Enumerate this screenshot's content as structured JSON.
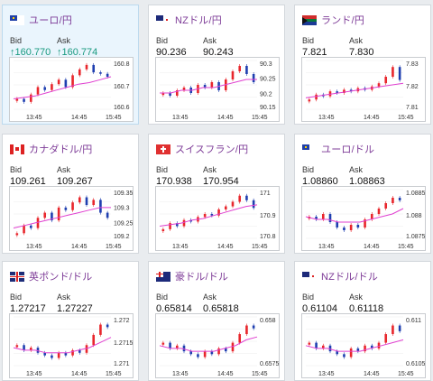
{
  "cards": [
    {
      "pair": "ユーロ/円",
      "flag": "eu",
      "active": true,
      "bid_label": "Bid",
      "ask_label": "Ask",
      "bid": "160.770",
      "ask": "160.774",
      "bid_arrow": "↑",
      "ask_arrow": "↑",
      "trend": "up",
      "y_labels": [
        "160.8",
        "160.7",
        "160.6"
      ],
      "x_labels": [
        "13:45",
        "14:45",
        "15:45"
      ],
      "chart_data": {
        "type": "candlestick",
        "x": [
          "13:45",
          "14:45",
          "15:45"
        ],
        "close": [
          160.62,
          160.6,
          160.65,
          160.7,
          160.68,
          160.72,
          160.75,
          160.7,
          160.78,
          160.82,
          160.85,
          160.8,
          160.79,
          160.77
        ],
        "ma": [
          160.62,
          160.63,
          160.64,
          160.66,
          160.68,
          160.7,
          160.72,
          160.73,
          160.75,
          160.77
        ],
        "ylim": [
          160.55,
          160.88
        ]
      }
    },
    {
      "pair": "NZドル/円",
      "flag": "nz",
      "active": false,
      "bid_label": "Bid",
      "ask_label": "Ask",
      "bid": "90.236",
      "ask": "90.243",
      "bid_arrow": "",
      "ask_arrow": "",
      "trend": "",
      "y_labels": [
        "90.3",
        "90.25",
        "90.2",
        "90.15"
      ],
      "x_labels": [
        "13:45",
        "14:45",
        "15:45"
      ],
      "chart_data": {
        "type": "candlestick",
        "x": [
          "13:45",
          "14:45",
          "15:45"
        ],
        "close": [
          90.2,
          90.19,
          90.21,
          90.22,
          90.2,
          90.23,
          90.22,
          90.24,
          90.21,
          90.25,
          90.28,
          90.3,
          90.27,
          90.24
        ],
        "ma": [
          90.2,
          90.2,
          90.21,
          90.21,
          90.22,
          90.22,
          90.23,
          90.24,
          90.25,
          90.25
        ],
        "ylim": [
          90.14,
          90.32
        ]
      }
    },
    {
      "pair": "ランド/円",
      "flag": "za",
      "active": false,
      "bid_label": "Bid",
      "ask_label": "Ask",
      "bid": "7.821",
      "ask": "7.830",
      "bid_arrow": "",
      "ask_arrow": "",
      "trend": "",
      "y_labels": [
        "7.83",
        "7.82",
        "7.81"
      ],
      "x_labels": [
        "13:45",
        "14:45",
        "15:45"
      ],
      "chart_data": {
        "type": "candlestick",
        "x": [
          "13:45",
          "14:45",
          "15:45"
        ],
        "close": [
          7.812,
          7.815,
          7.814,
          7.817,
          7.816,
          7.818,
          7.817,
          7.819,
          7.818,
          7.82,
          7.822,
          7.826,
          7.832,
          7.824
        ],
        "ma": [
          7.813,
          7.814,
          7.815,
          7.816,
          7.817,
          7.818,
          7.819,
          7.82,
          7.821,
          7.822
        ],
        "ylim": [
          7.806,
          7.836
        ]
      }
    },
    {
      "pair": "カナダドル/円",
      "flag": "ca",
      "active": false,
      "bid_label": "Bid",
      "ask_label": "Ask",
      "bid": "109.261",
      "ask": "109.267",
      "bid_arrow": "",
      "ask_arrow": "",
      "trend": "",
      "y_labels": [
        "109.35",
        "109.3",
        "109.25",
        "109.2"
      ],
      "x_labels": [
        "13:45",
        "14:45",
        "15:45"
      ],
      "chart_data": {
        "type": "candlestick",
        "x": [
          "13:45",
          "14:45",
          "15:45"
        ],
        "close": [
          109.2,
          109.23,
          109.22,
          109.26,
          109.28,
          109.25,
          109.3,
          109.29,
          109.32,
          109.34,
          109.31,
          109.33,
          109.28,
          109.26
        ],
        "ma": [
          109.22,
          109.23,
          109.24,
          109.25,
          109.26,
          109.27,
          109.28,
          109.29,
          109.3,
          109.3
        ],
        "ylim": [
          109.18,
          109.37
        ]
      }
    },
    {
      "pair": "スイスフラン/円",
      "flag": "ch",
      "active": false,
      "bid_label": "Bid",
      "ask_label": "Ask",
      "bid": "170.938",
      "ask": "170.954",
      "bid_arrow": "",
      "ask_arrow": "",
      "trend": "",
      "y_labels": [
        "171",
        "170.9",
        "170.8"
      ],
      "x_labels": [
        "13:45",
        "14:45",
        "15:45"
      ],
      "chart_data": {
        "type": "candlestick",
        "x": [
          "13:45",
          "14:45",
          "15:45"
        ],
        "close": [
          170.8,
          170.84,
          170.82,
          170.86,
          170.85,
          170.88,
          170.9,
          170.89,
          170.93,
          170.95,
          170.98,
          171.02,
          170.99,
          170.94
        ],
        "ma": [
          170.82,
          170.83,
          170.84,
          170.86,
          170.87,
          170.89,
          170.91,
          170.93,
          170.95,
          170.96
        ],
        "ylim": [
          170.74,
          171.06
        ]
      }
    },
    {
      "pair": "ユーロ/ドル",
      "flag": "eu",
      "active": false,
      "bid_label": "Bid",
      "ask_label": "Ask",
      "bid": "1.08860",
      "ask": "1.08863",
      "bid_arrow": "",
      "ask_arrow": "",
      "trend": "",
      "y_labels": [
        "1.0885",
        "1.088",
        "1.0875"
      ],
      "x_labels": [
        "13:45",
        "14:45",
        "15:45"
      ],
      "chart_data": {
        "type": "candlestick",
        "x": [
          "13:45",
          "14:45",
          "15:45"
        ],
        "close": [
          1.088,
          1.0879,
          1.0881,
          1.0878,
          1.0876,
          1.0875,
          1.0877,
          1.0876,
          1.0879,
          1.0881,
          1.0883,
          1.0885,
          1.0887,
          1.0886
        ],
        "ma": [
          1.088,
          1.0879,
          1.0879,
          1.0878,
          1.0878,
          1.0878,
          1.0879,
          1.088,
          1.0881,
          1.0883
        ],
        "ylim": [
          1.0872,
          1.089
        ]
      }
    },
    {
      "pair": "英ポンド/ドル",
      "flag": "gb",
      "active": false,
      "bid_label": "Bid",
      "ask_label": "Ask",
      "bid": "1.27217",
      "ask": "1.27227",
      "bid_arrow": "",
      "ask_arrow": "",
      "trend": "",
      "y_labels": [
        "1.272",
        "1.2715",
        "1.271"
      ],
      "x_labels": [
        "13:45",
        "14:45",
        "15:45"
      ],
      "chart_data": {
        "type": "candlestick",
        "x": [
          "13:45",
          "14:45",
          "15:45"
        ],
        "close": [
          1.2714,
          1.2712,
          1.2713,
          1.2711,
          1.271,
          1.2709,
          1.2711,
          1.271,
          1.2712,
          1.2711,
          1.2714,
          1.2718,
          1.2722,
          1.2721
        ],
        "ma": [
          1.2713,
          1.2712,
          1.2712,
          1.2711,
          1.2711,
          1.2711,
          1.2712,
          1.2713,
          1.2715,
          1.2717
        ],
        "ylim": [
          1.2706,
          1.2725
        ]
      }
    },
    {
      "pair": "豪ドル/ドル",
      "flag": "au",
      "active": false,
      "bid_label": "Bid",
      "ask_label": "Ask",
      "bid": "0.65814",
      "ask": "0.65818",
      "bid_arrow": "",
      "ask_arrow": "",
      "trend": "",
      "y_labels": [
        "0.658",
        "0.6575"
      ],
      "x_labels": [
        "13:45",
        "14:45",
        "15:45"
      ],
      "chart_data": {
        "type": "candlestick",
        "x": [
          "13:45",
          "14:45",
          "15:45"
        ],
        "close": [
          0.6576,
          0.6574,
          0.6575,
          0.6573,
          0.6572,
          0.6571,
          0.6573,
          0.6572,
          0.6574,
          0.6573,
          0.6576,
          0.6579,
          0.6582,
          0.6581
        ],
        "ma": [
          0.6575,
          0.6574,
          0.6574,
          0.6573,
          0.6573,
          0.6573,
          0.6574,
          0.6575,
          0.6577,
          0.6578
        ],
        "ylim": [
          0.6568,
          0.6585
        ]
      }
    },
    {
      "pair": "NZドル/ドル",
      "flag": "nz",
      "active": false,
      "bid_label": "Bid",
      "ask_label": "Ask",
      "bid": "0.61104",
      "ask": "0.61118",
      "bid_arrow": "",
      "ask_arrow": "",
      "trend": "",
      "y_labels": [
        "0.611",
        "0.6105"
      ],
      "x_labels": [
        "13:45",
        "14:45",
        "15:45"
      ],
      "chart_data": {
        "type": "candlestick",
        "x": [
          "13:45",
          "14:45",
          "15:45"
        ],
        "close": [
          0.6108,
          0.6106,
          0.6107,
          0.6105,
          0.6104,
          0.6103,
          0.6106,
          0.6105,
          0.6107,
          0.6106,
          0.6108,
          0.6111,
          0.6114,
          0.6112
        ],
        "ma": [
          0.6107,
          0.6106,
          0.6106,
          0.6105,
          0.6105,
          0.6105,
          0.6106,
          0.6107,
          0.6108,
          0.6109
        ],
        "ylim": [
          0.61,
          0.6117
        ]
      }
    }
  ],
  "colors": {
    "up": "#e8262c",
    "down": "#1f3fb0",
    "ma": "#e040d0",
    "pair": "#7d3b97",
    "rise": "#1a9a80"
  }
}
